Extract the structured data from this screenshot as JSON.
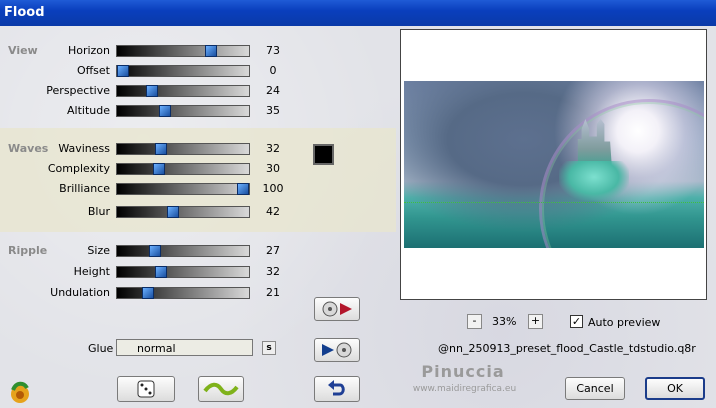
{
  "window": {
    "title": "Flood"
  },
  "sections": {
    "view": {
      "label": "View"
    },
    "waves": {
      "label": "Waves"
    },
    "ripple": {
      "label": "Ripple"
    }
  },
  "params": [
    {
      "label": "Horizon",
      "value": "73",
      "fraction": 0.73
    },
    {
      "label": "Offset",
      "value": "0",
      "fraction": 0.0
    },
    {
      "label": "Perspective",
      "value": "24",
      "fraction": 0.24
    },
    {
      "label": "Altitude",
      "value": "35",
      "fraction": 0.35
    },
    {
      "label": "Waviness",
      "value": "32",
      "fraction": 0.32
    },
    {
      "label": "Complexity",
      "value": "30",
      "fraction": 0.3
    },
    {
      "label": "Brilliance",
      "value": "100",
      "fraction": 1.0
    },
    {
      "label": "Blur",
      "value": "42",
      "fraction": 0.42
    },
    {
      "label": "Size",
      "value": "27",
      "fraction": 0.27
    },
    {
      "label": "Height",
      "value": "32",
      "fraction": 0.32
    },
    {
      "label": "Undulation",
      "value": "21",
      "fraction": 0.21
    }
  ],
  "color_swatch": "#000000",
  "glue": {
    "label": "Glue",
    "value": "normal",
    "s_button": "s"
  },
  "zoom": {
    "minus": "-",
    "value": "33%",
    "plus": "+"
  },
  "auto_preview": {
    "label": "Auto preview",
    "checked": "✓"
  },
  "preset": {
    "name": "@nn_250913_preset_flood_Castle_tdstudio.q8r"
  },
  "watermark": {
    "name": "Pinuccia",
    "url": "www.maidiregrafica.eu"
  },
  "buttons": {
    "cancel": "Cancel",
    "ok": "OK"
  }
}
